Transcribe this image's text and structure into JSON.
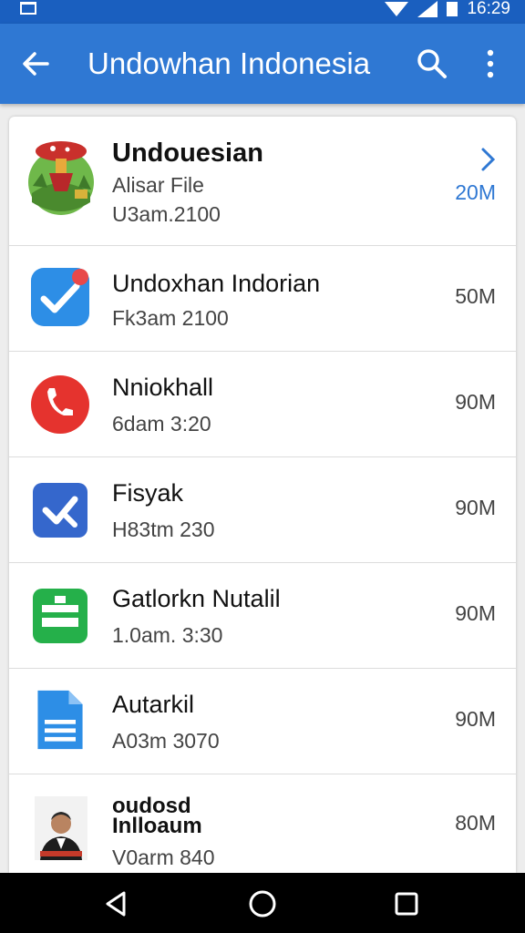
{
  "status_bar": {
    "time": "16:29",
    "icons": [
      "screenshot-icon",
      "wifi-icon",
      "signal-icon",
      "battery-icon"
    ]
  },
  "app_bar": {
    "title": "Undowhan Indonesia",
    "background": "#2f78d3",
    "icons": [
      "back-arrow-icon",
      "search-icon",
      "more-vert-icon"
    ]
  },
  "items": [
    {
      "title": "Undouesian",
      "line1": "Alisar File",
      "line2": "U3am.2100",
      "size": "20M",
      "icon": "mushroom-illustration-icon",
      "accent": "#2f78d3"
    },
    {
      "title": "Undoxhan Indorian",
      "line2": "Fk3am 2100",
      "size": "50M",
      "icon": "blue-check-app-icon"
    },
    {
      "title": "Nniokhall",
      "line2": "6dam 3:20",
      "size": "90M",
      "icon": "red-phone-app-icon"
    },
    {
      "title": "Fisyak",
      "line2": "H83tm 230",
      "size": "90M",
      "icon": "blue-tool-app-icon"
    },
    {
      "title": "Gatlorkn Nutalil",
      "line2": "1.0am. 3:30",
      "size": "90M",
      "icon": "green-briefcase-app-icon"
    },
    {
      "title": "Autarkil",
      "line2": "A03m 3070",
      "size": "90M",
      "icon": "blue-document-app-icon"
    },
    {
      "title": "oudosd Inlloaum",
      "line2": "V0arm 840",
      "size": "80M",
      "icon": "person-photo-icon"
    }
  ],
  "nav_bar": {
    "icons": [
      "back-triangle-icon",
      "home-circle-icon",
      "recents-square-icon"
    ]
  }
}
